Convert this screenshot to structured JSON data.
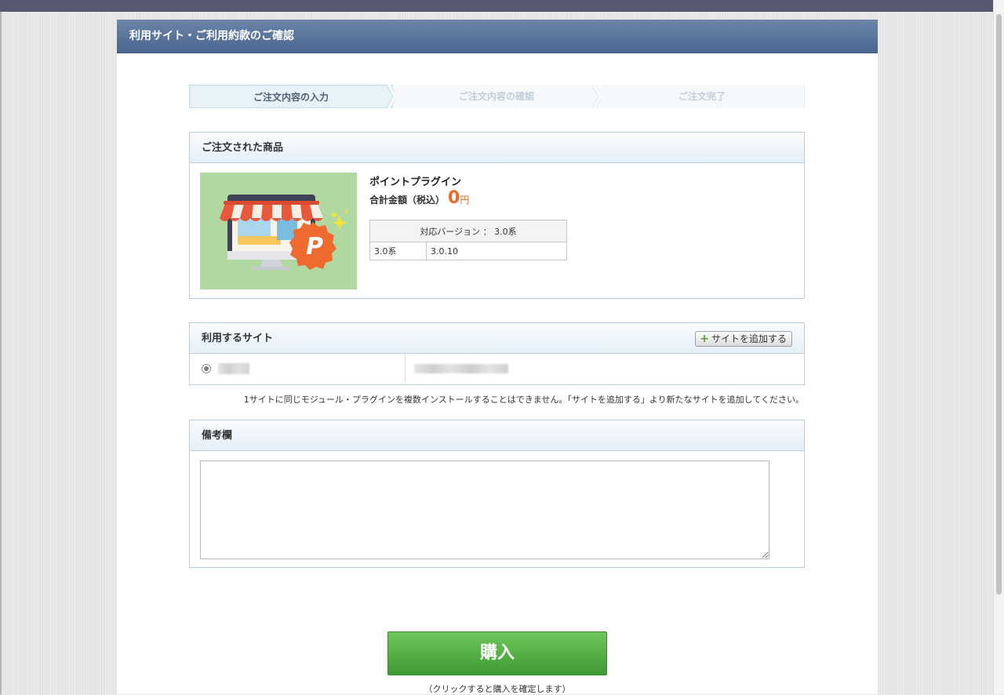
{
  "header": {
    "title": "利用サイト・ご利用約款のご確認"
  },
  "steps": [
    {
      "label": "ご注文内容の入力",
      "active": true
    },
    {
      "label": "ご注文内容の確認",
      "active": false
    },
    {
      "label": "ご注文完了",
      "active": false
    }
  ],
  "order": {
    "heading": "ご注文された商品",
    "product_name": "ポイントプラグイン",
    "price_label": "合計金額（税込）",
    "price_value": "0",
    "price_unit": "円",
    "version_table": {
      "header": "対応バージョン ： 3.0系",
      "rows": [
        {
          "series": "3.0系",
          "version": "3.0.10"
        }
      ]
    },
    "thumbnail_icon": "shop-plugin-icon"
  },
  "site": {
    "heading": "利用するサイト",
    "add_button_label": "サイトを追加する",
    "note": "1サイトに同じモジュール・プラグインを複数インストールすることはできません。「サイトを追加する」より新たなサイトを追加してください。"
  },
  "remarks": {
    "heading": "備考欄",
    "value": ""
  },
  "purchase": {
    "button_label": "購入",
    "note": "（クリックすると購入を確定します）"
  },
  "colors": {
    "header_bg": "#4a6590",
    "accent_orange": "#f26722",
    "buy_green": "#3f9a34"
  }
}
